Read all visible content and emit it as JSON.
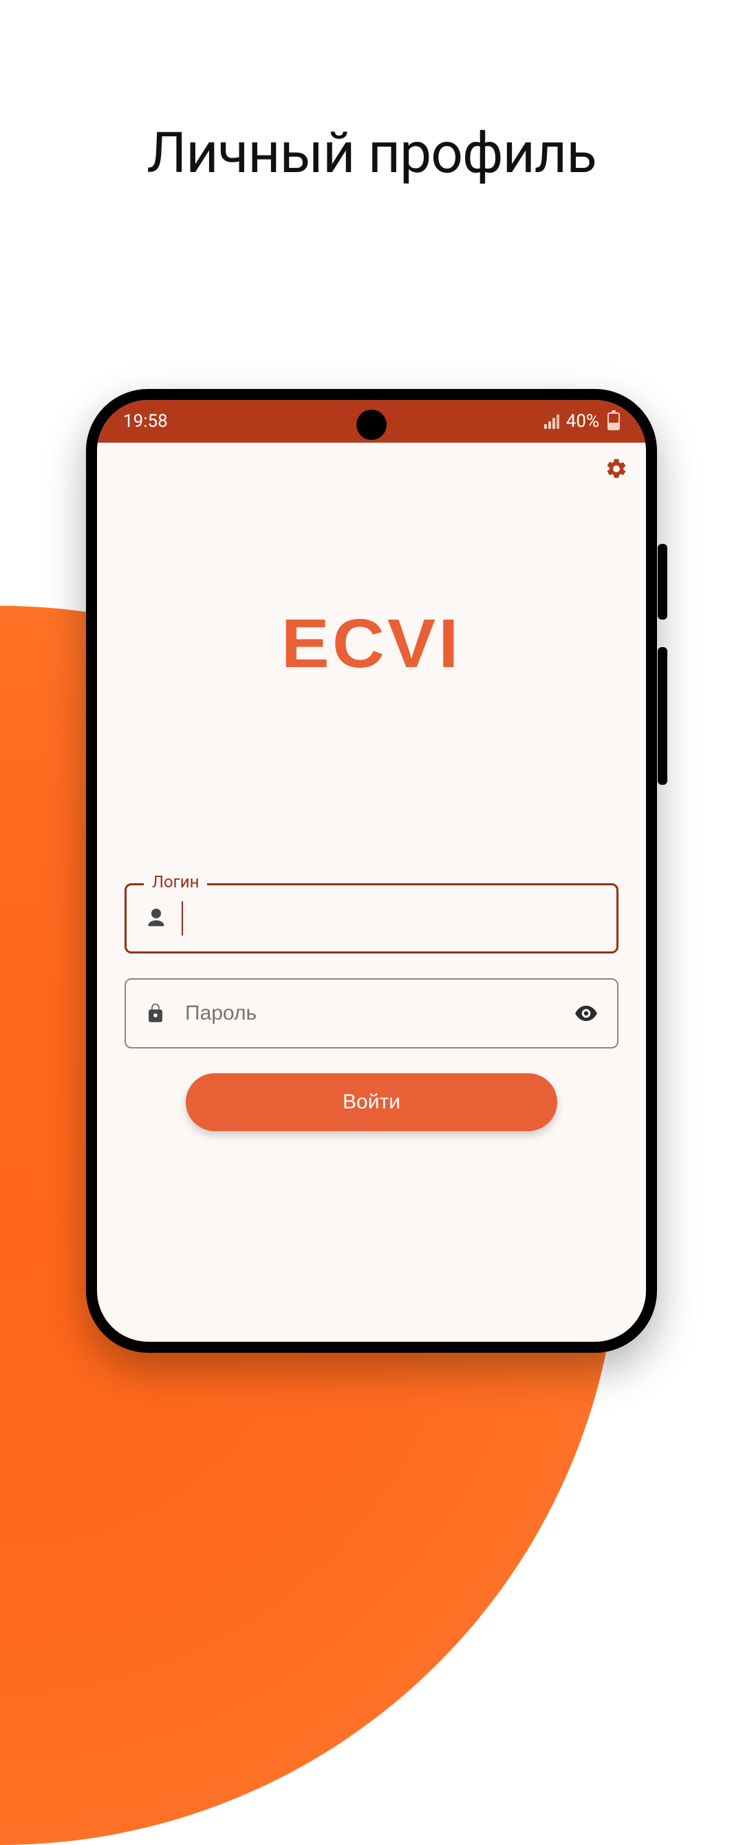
{
  "page": {
    "title": "Личный профиль"
  },
  "statusbar": {
    "time": "19:58",
    "battery_pct": "40%"
  },
  "brand": {
    "logo_text": "ECVI",
    "accent": "#e95f36",
    "accent_dark": "#b23a1b"
  },
  "form": {
    "login_label": "Логин",
    "login_value": "",
    "password_placeholder": "Пароль",
    "password_value": "",
    "submit_label": "Войти"
  },
  "icons": {
    "gear": "gear-icon",
    "person": "person-icon",
    "lock": "lock-icon",
    "eye": "eye-icon",
    "signal": "signal-icon",
    "battery": "battery-icon"
  }
}
